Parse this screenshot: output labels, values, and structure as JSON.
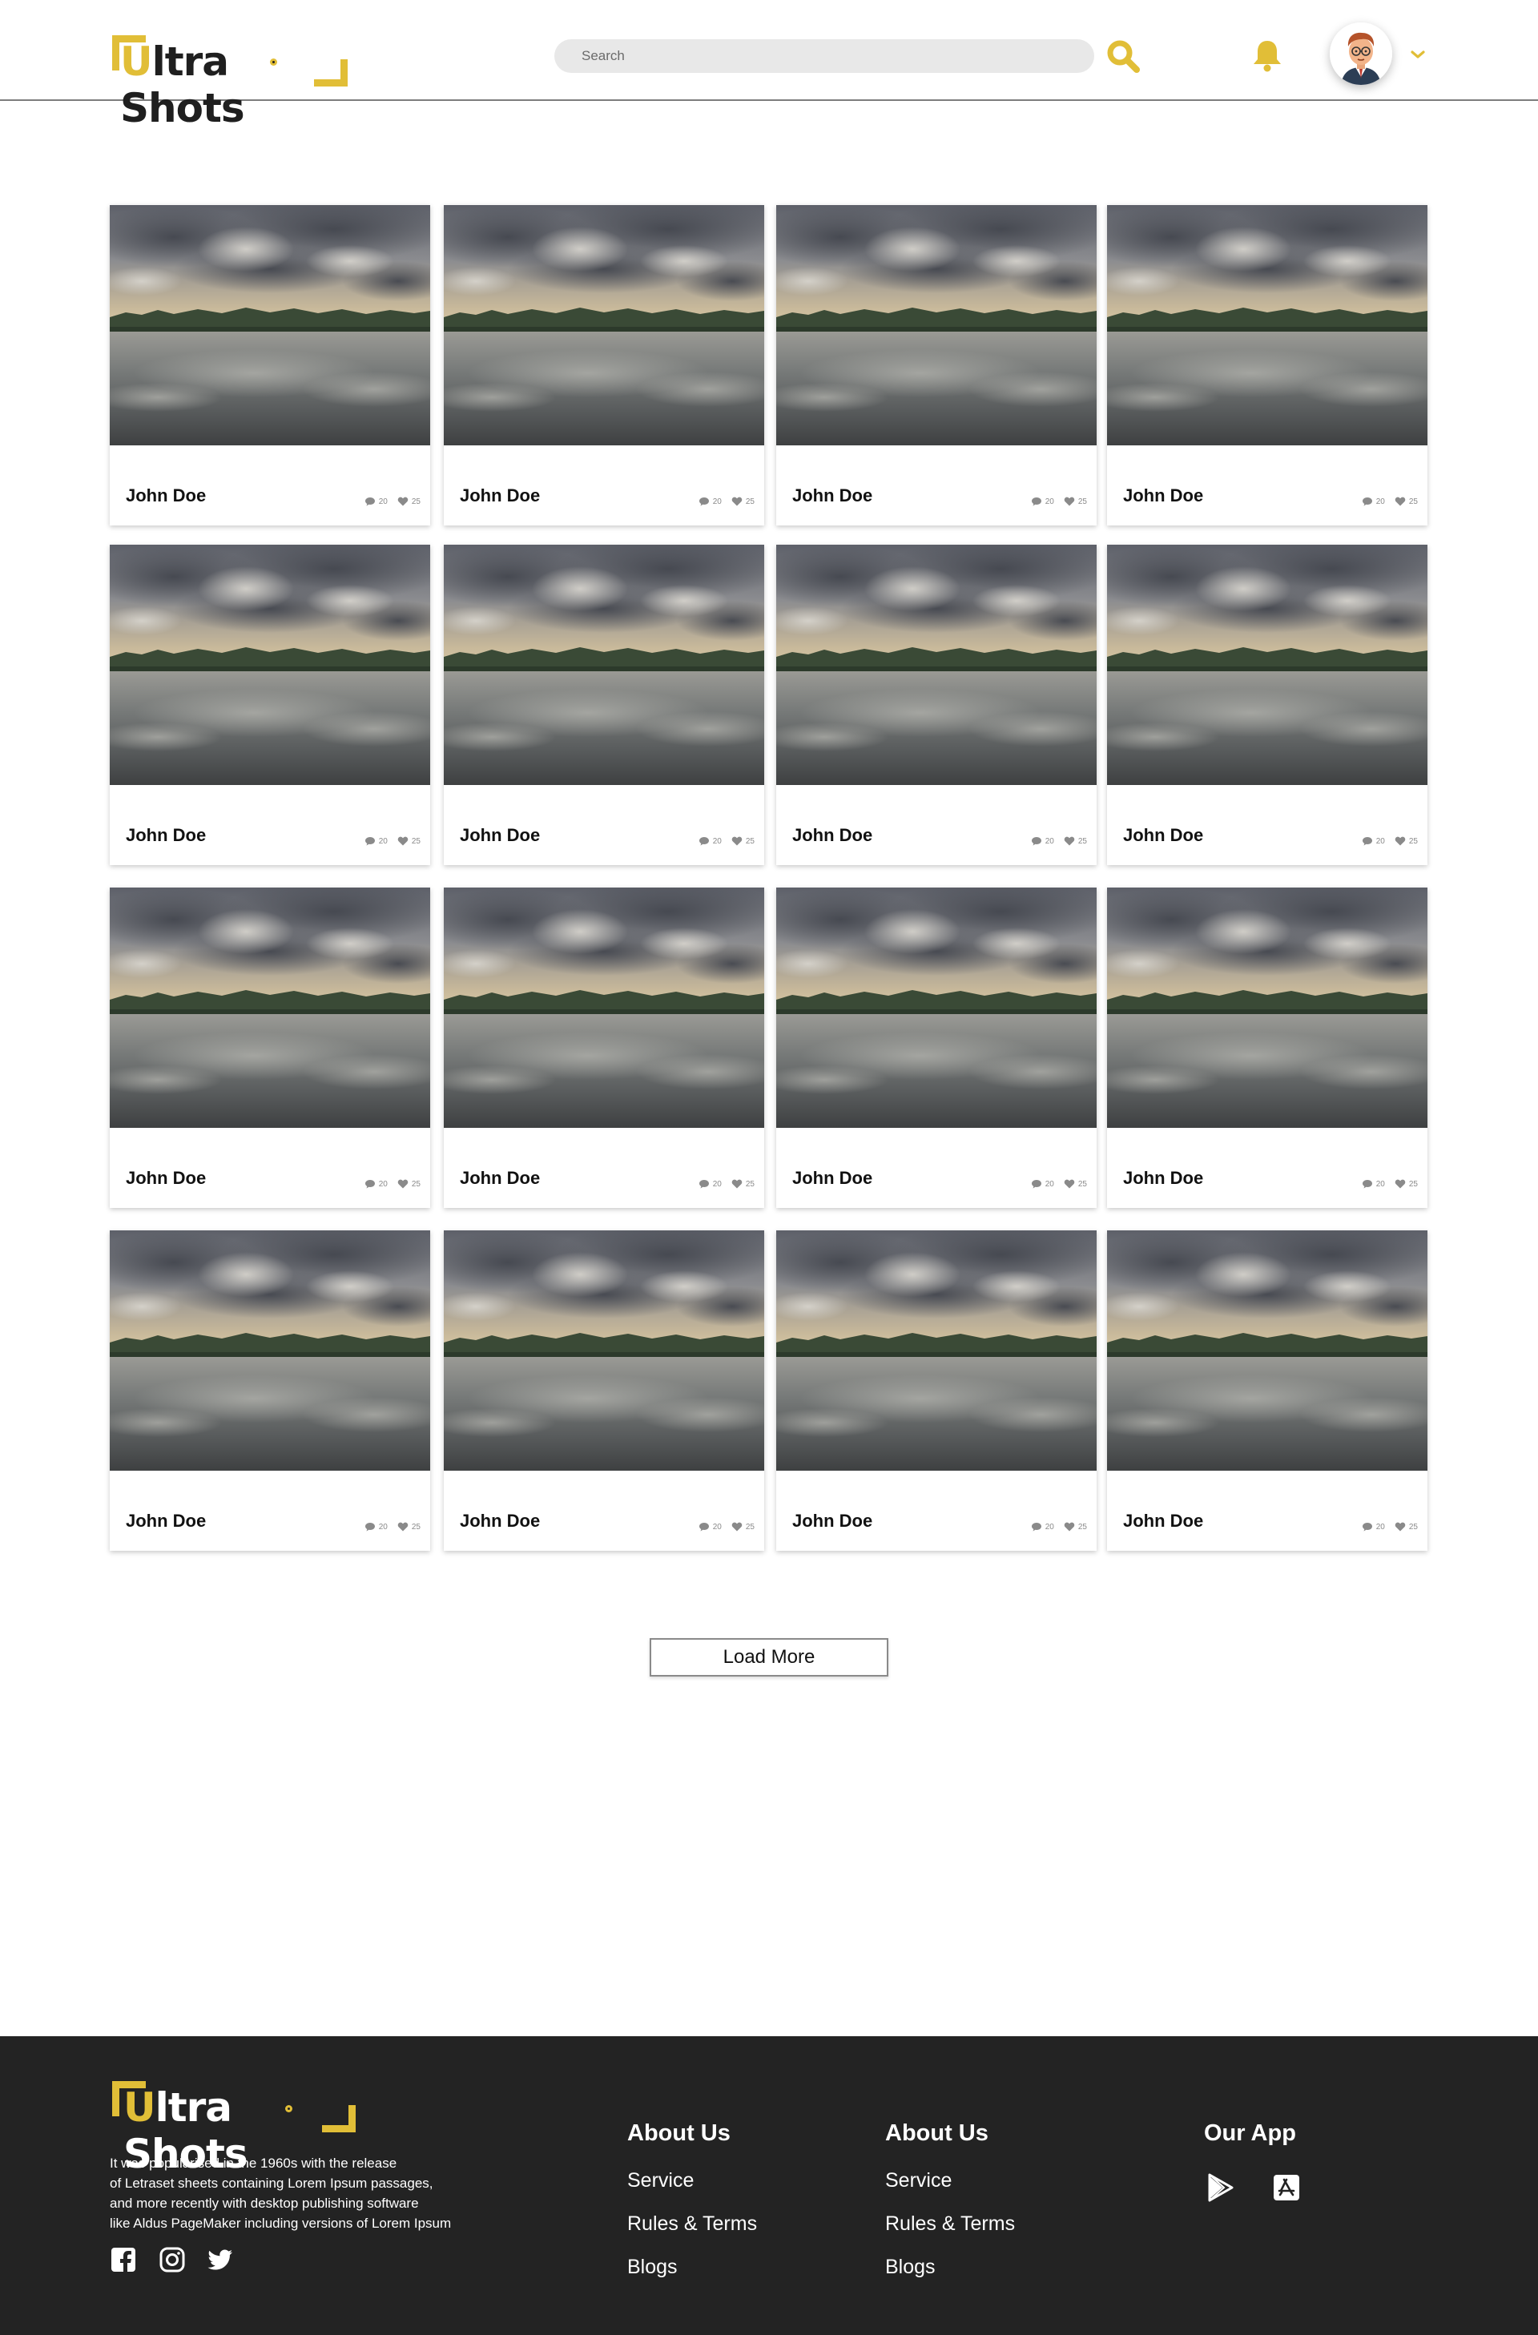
{
  "brand": {
    "first_letter": "U",
    "rest": "ltra Shots"
  },
  "header": {
    "search_placeholder": "Search",
    "search_icon": "search-icon",
    "bell_icon": "bell-icon",
    "avatar_icon": "avatar",
    "caret_icon": "chevron-down-icon"
  },
  "colors": {
    "accent": "#e1be37",
    "footer_bg": "#232323",
    "text": "#111111",
    "muted": "#8a8a8a"
  },
  "cards": [
    {
      "name": "John Doe",
      "comments": "20",
      "likes": "25"
    },
    {
      "name": "John Doe",
      "comments": "20",
      "likes": "25"
    },
    {
      "name": "John Doe",
      "comments": "20",
      "likes": "25"
    },
    {
      "name": "John Doe",
      "comments": "20",
      "likes": "25"
    },
    {
      "name": "John Doe",
      "comments": "20",
      "likes": "25"
    },
    {
      "name": "John Doe",
      "comments": "20",
      "likes": "25"
    },
    {
      "name": "John Doe",
      "comments": "20",
      "likes": "25"
    },
    {
      "name": "John Doe",
      "comments": "20",
      "likes": "25"
    },
    {
      "name": "John Doe",
      "comments": "20",
      "likes": "25"
    },
    {
      "name": "John Doe",
      "comments": "20",
      "likes": "25"
    },
    {
      "name": "John Doe",
      "comments": "20",
      "likes": "25"
    },
    {
      "name": "John Doe",
      "comments": "20",
      "likes": "25"
    },
    {
      "name": "John Doe",
      "comments": "20",
      "likes": "25"
    },
    {
      "name": "John Doe",
      "comments": "20",
      "likes": "25"
    },
    {
      "name": "John Doe",
      "comments": "20",
      "likes": "25"
    },
    {
      "name": "John Doe",
      "comments": "20",
      "likes": "25"
    }
  ],
  "load_more_label": "Load More",
  "footer": {
    "description": "It was popularised in the 1960s with the release\nof Letraset sheets containing Lorem Ipsum passages,\nand more recently with desktop publishing software\nlike Aldus PageMaker including versions of Lorem Ipsum",
    "social_icons": [
      "facebook-icon",
      "instagram-icon",
      "twitter-icon"
    ],
    "col1": {
      "heading": "About Us",
      "links": [
        "Service",
        "Rules & Terms",
        "Blogs"
      ]
    },
    "col2": {
      "heading": "About Us",
      "links": [
        "Service",
        "Rules & Terms",
        "Blogs"
      ]
    },
    "app": {
      "heading": "Our App",
      "icons": [
        "google-play-icon",
        "app-store-icon"
      ]
    }
  }
}
